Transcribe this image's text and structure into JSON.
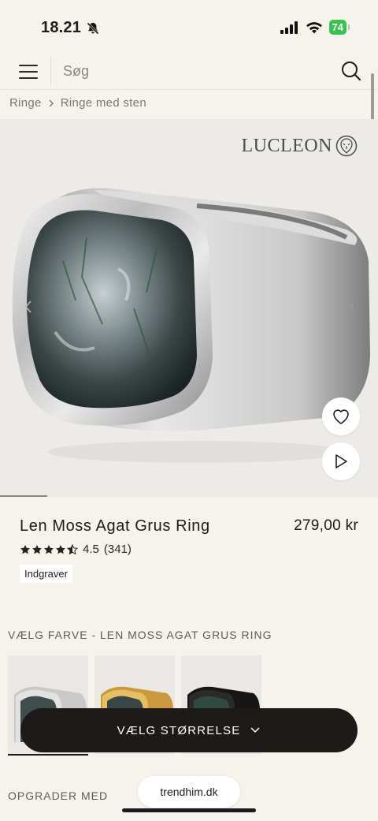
{
  "status_bar": {
    "time": "18.21",
    "battery": "74"
  },
  "search": {
    "placeholder": "Søg"
  },
  "breadcrumb": {
    "items": [
      "Ringe",
      "Ringe med sten"
    ]
  },
  "gallery": {
    "brand": "LUCLEON",
    "progress_fraction": 0.125
  },
  "product": {
    "title": "Len Moss Agat Grus Ring",
    "price": "279,00 kr",
    "rating": "4.5",
    "review_count": "(341)",
    "engrave_label": "Indgraver"
  },
  "colour": {
    "label": "VÆLG FARVE - LEN MOSS AGAT GRUS RING",
    "swatches": [
      "silver",
      "gold",
      "black"
    ]
  },
  "size_button": {
    "label": "VÆLG STØRRELSE"
  },
  "upgrade": {
    "label": "OPGRADER MED"
  },
  "browser": {
    "domain": "trendhim.dk"
  },
  "colors": {
    "background": "#f6f2ec",
    "button": "#1d1b19",
    "battery": "#37c34f"
  }
}
